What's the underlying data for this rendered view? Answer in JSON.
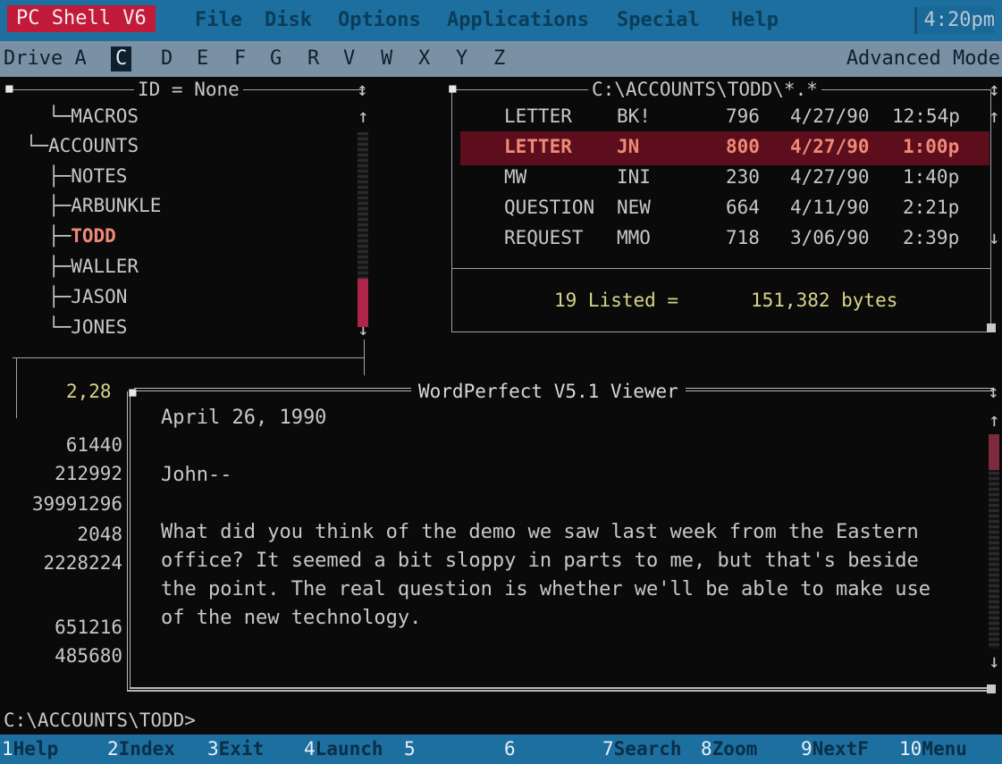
{
  "menubar": {
    "app_title": "PC Shell V6",
    "items": [
      "File",
      "Disk",
      "Options",
      "Applications",
      "Special",
      "Help"
    ],
    "clock": "4:20pm"
  },
  "drivebar": {
    "label": "Drive A",
    "selected_drive": "C",
    "drives": [
      "D",
      "E",
      "F",
      "G",
      "R",
      "V",
      "W",
      "X",
      "Y",
      "Z"
    ],
    "mode": "Advanced Mode"
  },
  "tree_panel": {
    "header": "ID = None",
    "items": [
      {
        "prefix": "   └─",
        "name": "MACROS"
      },
      {
        "prefix": " └─",
        "name": "ACCOUNTS"
      },
      {
        "prefix": "   ├─",
        "name": "NOTES"
      },
      {
        "prefix": "   ├─",
        "name": "ARBUNKLE"
      },
      {
        "prefix": "   ├─",
        "name": "TODD"
      },
      {
        "prefix": "   ├─",
        "name": "WALLER"
      },
      {
        "prefix": "   ├─",
        "name": "JASON"
      },
      {
        "prefix": "   └─",
        "name": "JONES"
      }
    ],
    "selected": "TODD",
    "position": "2,28"
  },
  "file_panel": {
    "path": "C:\\ACCOUNTS\\TODD\\*.*",
    "files": [
      {
        "name": "LETTER",
        "ext": "BK!",
        "size": "796",
        "date": "4/27/90",
        "time": "12:54p"
      },
      {
        "name": "LETTER",
        "ext": "JN",
        "size": "800",
        "date": "4/27/90",
        "time": "1:00p"
      },
      {
        "name": "MW",
        "ext": "INI",
        "size": "230",
        "date": "4/27/90",
        "time": "1:40p"
      },
      {
        "name": "QUESTION",
        "ext": "NEW",
        "size": "664",
        "date": "4/11/90",
        "time": "2:21p"
      },
      {
        "name": "REQUEST",
        "ext": "MMO",
        "size": "718",
        "date": "3/06/90",
        "time": "2:39p"
      }
    ],
    "selected_index": 1,
    "summary_count": "19 Listed =",
    "summary_bytes": "151,382 bytes"
  },
  "side_numbers": [
    "61440",
    "212992",
    "39991296",
    "2048",
    "2228224",
    "",
    "651216",
    "485680"
  ],
  "viewer": {
    "title": "WordPerfect V5.1 Viewer",
    "lines": [
      "April 26, 1990",
      "",
      "John--",
      "",
      "What did you think of the demo we saw last week from the Eastern",
      "office? It seemed a bit sloppy in parts to me, but that's beside",
      "the point. The real question is whether we'll be able to make use",
      "of the new technology."
    ]
  },
  "prompt": "C:\\ACCOUNTS\\TODD>",
  "fkeys": [
    {
      "num": "1",
      "label": "Help"
    },
    {
      "num": "2",
      "label": "Index"
    },
    {
      "num": "3",
      "label": "Exit"
    },
    {
      "num": "4",
      "label": "Launch"
    },
    {
      "num": "5",
      "label": ""
    },
    {
      "num": "6",
      "label": ""
    },
    {
      "num": "7",
      "label": "Search"
    },
    {
      "num": "8",
      "label": "Zoom"
    },
    {
      "num": "9",
      "label": "NextF"
    },
    {
      "num": "10",
      "label": "Menu"
    }
  ]
}
